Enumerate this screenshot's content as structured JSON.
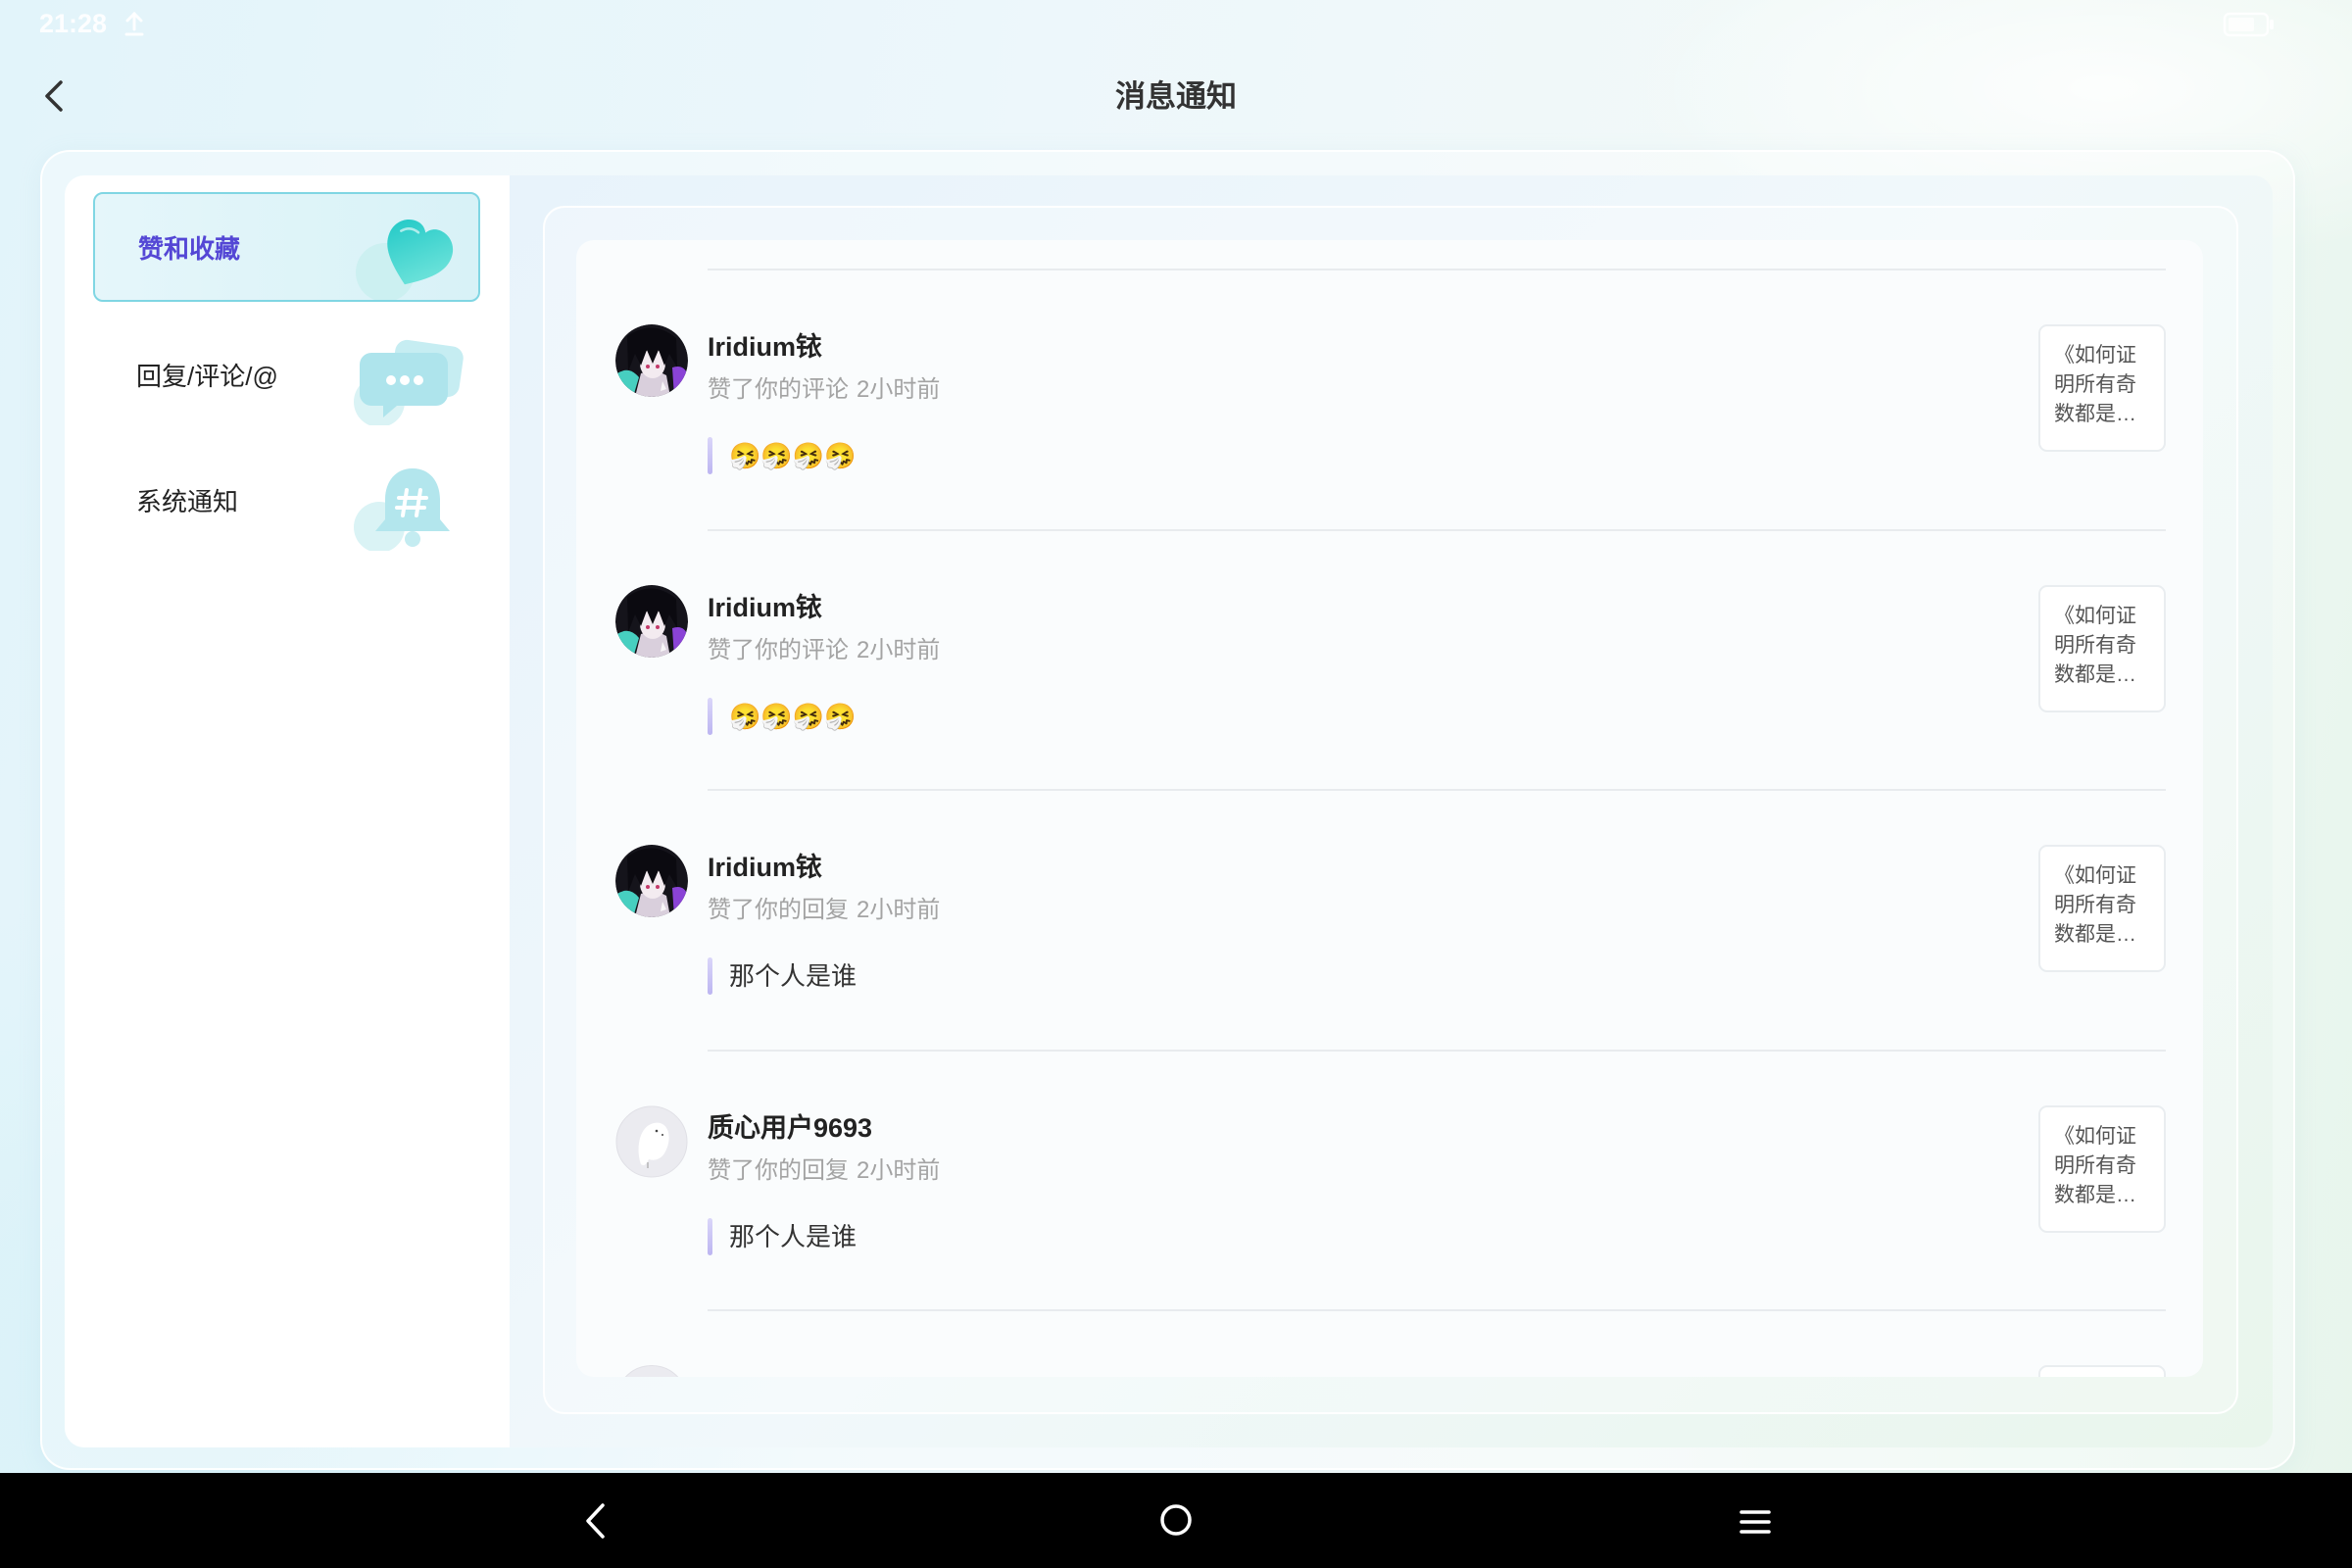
{
  "status_bar": {
    "time": "21:28",
    "upload_icon": "upload-icon",
    "battery_icon": "battery-icon"
  },
  "header": {
    "back_icon": "chevron-left-icon",
    "title": "消息通知"
  },
  "sidebar": {
    "selected_index": 0,
    "items": [
      {
        "label": "赞和收藏",
        "icon": "heart-icon"
      },
      {
        "label": "回复/评论/@",
        "icon": "chat-bubble-icon"
      },
      {
        "label": "系统通知",
        "icon": "bell-icon"
      }
    ]
  },
  "notifications": [
    {
      "user": "Iridium铱",
      "avatar_icon": "anime-avatar",
      "action": "赞了你的评论",
      "time": "2小时前",
      "content": "🤧🤧🤧🤧",
      "target_lines": [
        "《如何证",
        "明所有奇",
        "数都是…"
      ]
    },
    {
      "user": "Iridium铱",
      "avatar_icon": "anime-avatar",
      "action": "赞了你的评论",
      "time": "2小时前",
      "content": "🤧🤧🤧🤧",
      "target_lines": [
        "《如何证",
        "明所有奇",
        "数都是…"
      ]
    },
    {
      "user": "Iridium铱",
      "avatar_icon": "anime-avatar",
      "action": "赞了你的回复",
      "time": "2小时前",
      "content": "那个人是谁",
      "target_lines": [
        "《如何证",
        "明所有奇",
        "数都是…"
      ]
    },
    {
      "user": "质心用户9693",
      "avatar_icon": "ghost-avatar",
      "action": "赞了你的回复",
      "time": "2小时前",
      "content": "那个人是谁",
      "target_lines": [
        "《如何证",
        "明所有奇",
        "数都是…"
      ]
    }
  ],
  "nav_bar": {
    "back_icon": "triangle-back-icon",
    "home_icon": "home-circle-icon",
    "menu_icon": "menu-lines-icon"
  },
  "colors": {
    "accent_text": "#5447d5",
    "selected_bg": "#dff4f8",
    "selected_border": "#80d6e3",
    "quote_bar": "#c5c0f4",
    "nav_background": "#000000"
  }
}
